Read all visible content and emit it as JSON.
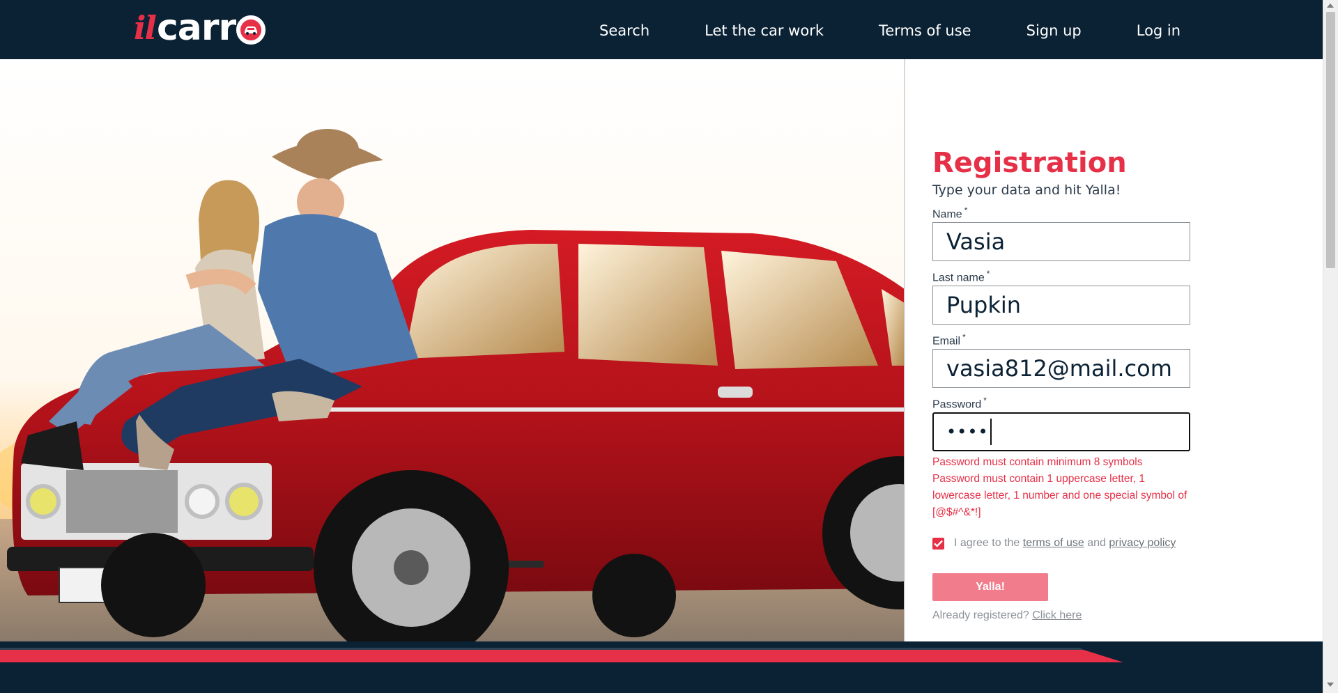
{
  "brand": {
    "logo_text_prefix": "il",
    "logo_text_main": "carr",
    "accent_color": "#e63047",
    "navy_color": "#0b2235"
  },
  "nav": {
    "items": [
      "Search",
      "Let the car work",
      "Terms of use",
      "Sign up",
      "Log in"
    ]
  },
  "hero": {
    "image_subject": "couple-sitting-on-red-car-photo"
  },
  "form": {
    "title": "Registration",
    "subtitle": "Type your data and hit Yalla!",
    "required_mark": "*",
    "name": {
      "label": "Name",
      "value": "Vasia"
    },
    "last_name": {
      "label": "Last name",
      "value": "Pupkin"
    },
    "email": {
      "label": "Email",
      "value": "vasia812@mail.com"
    },
    "password": {
      "label": "Password",
      "masked_value": "••••"
    },
    "errors": {
      "line1": "Password must contain minimum 8 symbols",
      "line2": "Password must contain 1 uppercase letter, 1 lowercase letter, 1 number and one special symbol of [@$#^&*!]"
    },
    "agree": {
      "checked": true,
      "prefix": "I agree to the",
      "terms_link": "terms of use",
      "middle": "and",
      "privacy_link": "privacy policy"
    },
    "submit_label": "Yalla!",
    "already_text": "Already registered?",
    "already_link": "Click here"
  }
}
